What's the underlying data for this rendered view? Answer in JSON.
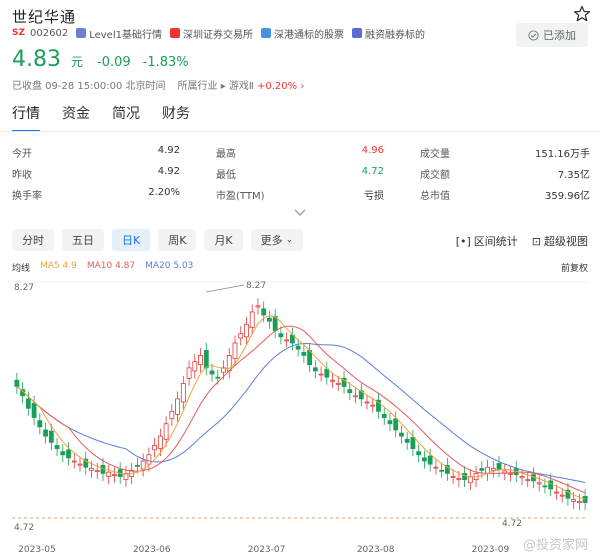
{
  "header": {
    "name": "世纪华通",
    "market": "SZ",
    "code": "002602",
    "tags": [
      "Level1基础行情",
      "深圳证券交易所",
      "深港通标的股票",
      "融资融券标的"
    ],
    "added_label": "已添加"
  },
  "quote": {
    "price": "4.83",
    "unit": "元",
    "change": "-0.09",
    "change_pct": "-1.83%",
    "status": "已收盘 09-28 15:00:00 北京时间",
    "industry_label": "所属行业",
    "industry": "游戏Ⅱ",
    "industry_change": "+0.20%"
  },
  "tabs": [
    "行情",
    "资金",
    "简况",
    "财务"
  ],
  "stats": [
    [
      {
        "label": "今开",
        "value": "4.92"
      },
      {
        "label": "最高",
        "value": "4.96",
        "color": "red"
      },
      {
        "label": "成交量",
        "value": "151.16万手"
      }
    ],
    [
      {
        "label": "昨收",
        "value": "4.92"
      },
      {
        "label": "最低",
        "value": "4.72",
        "color": "green"
      },
      {
        "label": "成交额",
        "value": "7.35亿"
      }
    ],
    [
      {
        "label": "换手率",
        "value": "2.20%"
      },
      {
        "label": "市盈(TTM)",
        "value": "亏损"
      },
      {
        "label": "总市值",
        "value": "359.96亿"
      }
    ]
  ],
  "periods": [
    "分时",
    "五日",
    "日K",
    "周K",
    "月K",
    "更多"
  ],
  "tools": [
    "区间统计",
    "超级视图"
  ],
  "ma": {
    "label": "均线",
    "ma5": "MA5 4.9",
    "ma10": "MA10 4.87",
    "ma20": "MA20 5.03",
    "adjust": "前复权"
  },
  "colors": {
    "up": "#e33b3b",
    "down": "#18a058",
    "ma5": "#f0a23b",
    "ma10": "#e55b5b",
    "ma20": "#5b7fd8"
  },
  "chart_data": {
    "type": "candlestick",
    "x_ticks": [
      "2023-05",
      "2023-06",
      "2023-07",
      "2023-08",
      "2023-09"
    ],
    "max_label": "8.27",
    "min_label": "4.72",
    "ylim": [
      4.55,
      8.35
    ],
    "close": [
      6.7,
      6.55,
      6.35,
      6.2,
      6.05,
      5.9,
      5.8,
      5.7,
      5.6,
      5.55,
      5.5,
      5.45,
      5.4,
      5.38,
      5.35,
      5.3,
      5.32,
      5.28,
      5.25,
      5.3,
      5.35,
      5.42,
      5.5,
      5.6,
      5.75,
      5.9,
      6.1,
      6.3,
      6.5,
      6.75,
      7.0,
      7.1,
      7.2,
      7.0,
      6.9,
      6.85,
      7.0,
      7.2,
      7.4,
      7.55,
      7.7,
      7.9,
      8.0,
      7.85,
      7.75,
      7.6,
      7.5,
      7.45,
      7.4,
      7.3,
      7.2,
      7.05,
      6.95,
      6.9,
      6.85,
      6.8,
      6.75,
      6.7,
      6.6,
      6.55,
      6.5,
      6.45,
      6.4,
      6.3,
      6.2,
      6.1,
      6.0,
      5.9,
      5.8,
      5.7,
      5.6,
      5.5,
      5.45,
      5.4,
      5.35,
      5.3,
      5.25,
      5.22,
      5.2,
      5.25,
      5.3,
      5.35,
      5.4,
      5.38,
      5.36,
      5.34,
      5.3,
      5.28,
      5.25,
      5.2,
      5.18,
      5.15,
      5.1,
      5.05,
      5.0,
      4.95,
      4.9,
      4.88,
      4.85,
      4.83
    ]
  },
  "watermark": "@投资家网"
}
